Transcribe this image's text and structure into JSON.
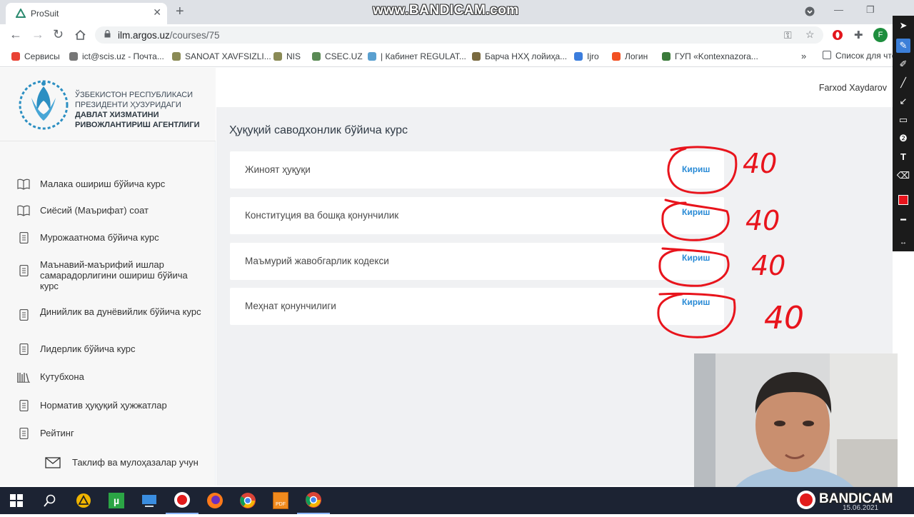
{
  "browser": {
    "tab_title": "ProSuit",
    "url_host": "ilm.argos.uz",
    "url_path": "/courses/75",
    "bookmarks": [
      {
        "label": "Сервисы",
        "color": "#e94235"
      },
      {
        "label": "ict@scis.uz - Почта...",
        "color": "#777777"
      },
      {
        "label": "SANOAT XAVFSIZLI...",
        "color": "#8a8a55"
      },
      {
        "label": "NIS",
        "color": "#8a8a55"
      },
      {
        "label": "CSEC.UZ",
        "color": "#5a8a55"
      },
      {
        "label": "| Кабинет REGULAT...",
        "color": "#5aa0d0"
      },
      {
        "label": "Барча НХҲ лойиҳа...",
        "color": "#7a6a40"
      },
      {
        "label": "Ijro",
        "color": "#3b7ddd"
      },
      {
        "label": "Логин",
        "color": "#f25022"
      },
      {
        "label": "ГУП «Kontexnazora...",
        "color": "#3a7a3a"
      }
    ],
    "bookmarks_overflow": "»",
    "reading_list": "Список для чте",
    "profile_initial": "F"
  },
  "watermark": {
    "top": "www.BANDICAM.com",
    "bottom": "BANDICAM"
  },
  "logo": {
    "line1": "ЎЗБЕКИСТОН РЕСПУБЛИКАСИ",
    "line2": "ПРЕЗИДЕНТИ ҲУЗУРИДАГИ",
    "line3": "ДАВЛАТ ХИЗМАТИНИ",
    "line4": "РИВОЖЛАНТИРИШ АГЕНТЛИГИ"
  },
  "sidebar": {
    "items": [
      {
        "label": "Малака ошириш бўйича курс",
        "icon": "book-icon"
      },
      {
        "label": "Сиёсий (Маърифат) соат",
        "icon": "book-icon"
      },
      {
        "label": "Мурожаатнома бўйича курс",
        "icon": "document-icon"
      },
      {
        "label": "Маънавий-маърифий ишлар самарадорлигини ошириш бўйича курс",
        "icon": "document-icon"
      },
      {
        "label": "Динийлик ва дунёвийлик бўйича курс",
        "icon": "document-icon"
      },
      {
        "label": "Лидерлик бўйича курс",
        "icon": "document-icon"
      },
      {
        "label": "Кутубхона",
        "icon": "library-icon"
      },
      {
        "label": "Норматив ҳуқуқий ҳужжатлар",
        "icon": "document-icon"
      },
      {
        "label": "Рейтинг",
        "icon": "document-icon"
      }
    ],
    "feedback": "Таклиф ва мулоҳазалар учун"
  },
  "header": {
    "user": "Farxod Xaydarov"
  },
  "main": {
    "title": "Ҳуқуқий саводхонлик бўйича курс",
    "courses": [
      {
        "name": "Жиноят ҳуқуқи",
        "action": "Кириш"
      },
      {
        "name": "Конституция ва бошқа қонунчилик",
        "action": "Кириш"
      },
      {
        "name": "Маъмурий жавобгарлик кодекси",
        "action": "Кириш"
      },
      {
        "name": "Меҳнат қонунчилиги",
        "action": "Кириш"
      }
    ]
  },
  "annotations": {
    "marks": [
      "40",
      "40",
      "40",
      "40"
    ],
    "color": "#e8141c"
  },
  "clock": "15.06.2021"
}
